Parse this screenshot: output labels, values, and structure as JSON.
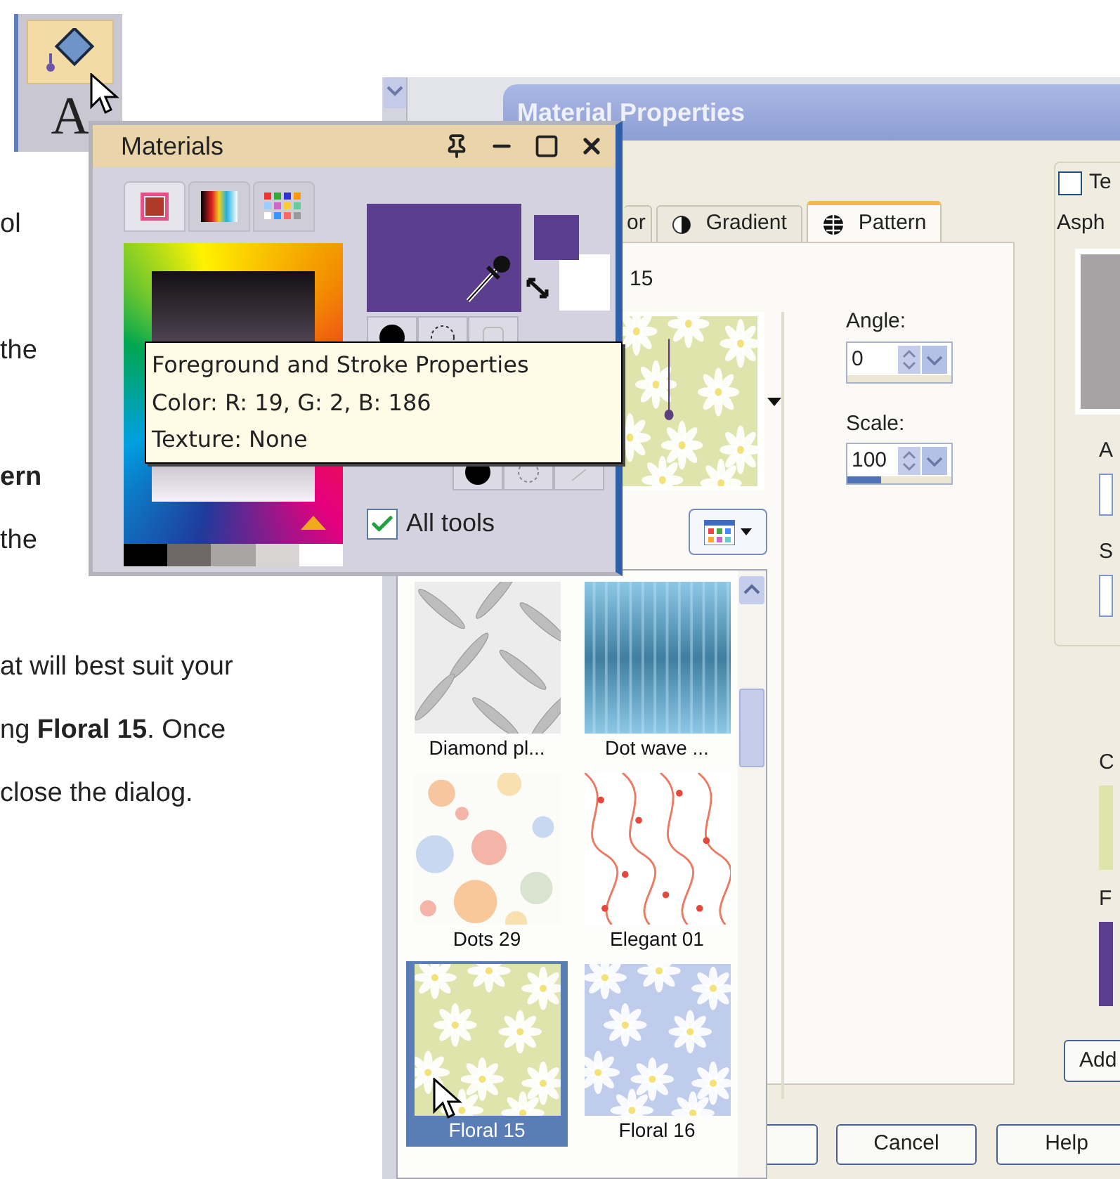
{
  "body_text": {
    "paragraphs": [
      [
        "ol"
      ],
      [
        "the"
      ],
      [
        "**ern**",
        "the"
      ],
      [
        "at will best suit your",
        "ng **Floral 15**. Once",
        "close the dialog."
      ]
    ]
  },
  "toolbar": {
    "tools": [
      {
        "kind": "fill",
        "selected": true
      },
      {
        "kind": "text",
        "label": "A",
        "selected": false
      }
    ]
  },
  "materials_palette": {
    "title": "Materials",
    "tabs": [
      {
        "kind": "frame",
        "selected": true
      },
      {
        "kind": "rainbow",
        "selected": false
      },
      {
        "kind": "swatches",
        "selected": false
      }
    ],
    "tooltip": [
      "Foreground and Stroke Properties",
      "Color: R: 19, G: 2, B: 186",
      "Texture: None"
    ],
    "all_tools": {
      "label": "All tools",
      "checked": true
    }
  },
  "material_properties": {
    "title": "Material Properties",
    "tabs": [
      {
        "kind": "color",
        "label": "or",
        "selected": false
      },
      {
        "kind": "gradient",
        "label": "Gradient",
        "selected": false
      },
      {
        "kind": "pattern",
        "label": "Pattern",
        "selected": true
      }
    ],
    "pattern_name": "15",
    "angle": {
      "label": "Angle:",
      "value": "0"
    },
    "scale": {
      "label": "Scale:",
      "value": "100",
      "level": 0.33
    },
    "patterns": [
      {
        "kind": "diamond",
        "name": "Diamond pl...",
        "selected": false
      },
      {
        "kind": "dotwave",
        "name": "Dot wave ...",
        "selected": false
      },
      {
        "kind": "dots",
        "name": "Dots 29",
        "selected": false
      },
      {
        "kind": "elegant",
        "name": "Elegant 01",
        "selected": false
      },
      {
        "kind": "floral_green",
        "name": "Floral 15",
        "selected": true
      },
      {
        "kind": "floral_blue",
        "name": "Floral 16",
        "selected": false
      }
    ],
    "texture": {
      "label": "Te",
      "checked": false,
      "name": "Asph"
    },
    "side_labels": [
      "A",
      "S"
    ],
    "swatch_labels": [
      "C",
      "F"
    ],
    "add_button": "Add",
    "buttons": [
      "Cancel",
      "Help"
    ]
  }
}
